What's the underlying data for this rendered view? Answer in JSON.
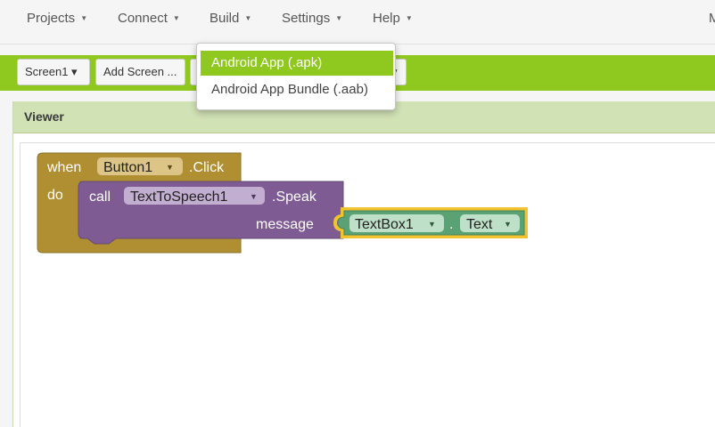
{
  "menu": {
    "projects": "Projects",
    "connect": "Connect",
    "build": "Build",
    "settings": "Settings",
    "help": "Help",
    "corner": "M"
  },
  "toolbar": {
    "screen_select": "Screen1 ▾",
    "add_screen": "Add Screen ...",
    "hidden_right_fragment": "y"
  },
  "build_menu": {
    "items": [
      "Android App (.apk)",
      "Android App Bundle (.aab)"
    ]
  },
  "viewer": {
    "title": "Viewer"
  },
  "blocks": {
    "event_when": "when",
    "event_component": "Button1",
    "event_name": ".Click",
    "event_do": "do",
    "call_label": "call",
    "call_component": "TextToSpeech1",
    "call_method": ".Speak",
    "call_param": "message",
    "getter_component": "TextBox1",
    "getter_dot": ".",
    "getter_property": "Text"
  },
  "colors": {
    "accent_green": "#8fc81e",
    "event_block": "#b08f33",
    "procedure_block": "#7e5c93",
    "component_block": "#5aa273",
    "selection_outline": "#f3c32f"
  }
}
